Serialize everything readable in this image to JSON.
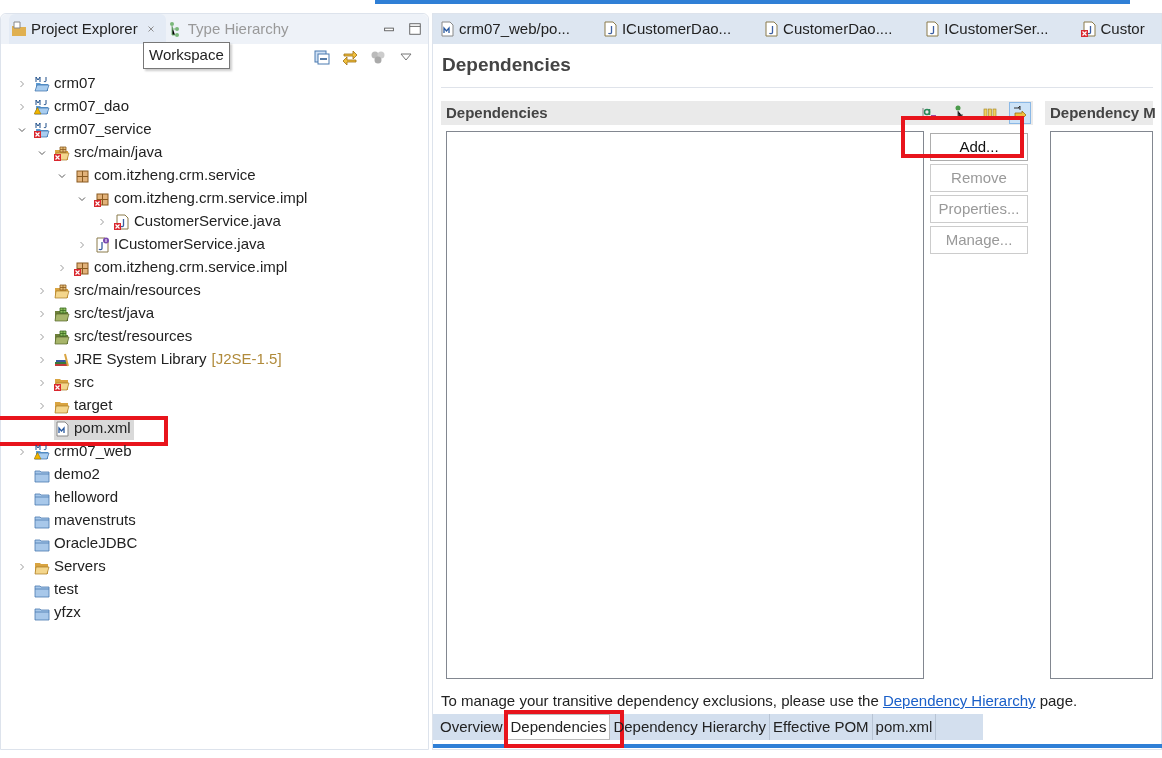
{
  "explorer": {
    "tabs": [
      {
        "label": "Project Explorer",
        "selected": true,
        "closable": true
      },
      {
        "label": "Type Hierarchy",
        "selected": false,
        "closable": false
      }
    ],
    "tooltip": "Workspace",
    "tree": [
      {
        "label": "crm07",
        "kind": "maven-project",
        "error": false,
        "warning": false,
        "expanded": false,
        "selected": false,
        "highlighted": false
      },
      {
        "label": "crm07_dao",
        "kind": "maven-project",
        "error": false,
        "warning": true,
        "expanded": false,
        "selected": false,
        "highlighted": false
      },
      {
        "label": "crm07_service",
        "kind": "maven-project",
        "error": true,
        "warning": false,
        "expanded": true,
        "selected": false,
        "highlighted": false,
        "children": [
          {
            "label": "src/main/java",
            "kind": "source-folder",
            "error": true,
            "warning": false,
            "expanded": true,
            "selected": false,
            "highlighted": false,
            "children": [
              {
                "label": "com.itzheng.crm.service",
                "kind": "package",
                "error": false,
                "warning": false,
                "expanded": true,
                "selected": false,
                "highlighted": false,
                "children": [
                  {
                    "label": "com.itzheng.crm.service.impl",
                    "kind": "package",
                    "error": true,
                    "warning": false,
                    "expanded": true,
                    "selected": false,
                    "highlighted": false,
                    "children": [
                      {
                        "label": "CustomerService.java",
                        "kind": "java-file",
                        "error": true,
                        "warning": false,
                        "expanded": false,
                        "selected": false,
                        "highlighted": false
                      }
                    ]
                  },
                  {
                    "label": "ICustomerService.java",
                    "kind": "interface-file",
                    "error": false,
                    "warning": false,
                    "expanded": false,
                    "selected": false,
                    "highlighted": false
                  }
                ]
              },
              {
                "label": "com.itzheng.crm.service.impl",
                "kind": "package",
                "error": true,
                "warning": false,
                "expanded": false,
                "selected": false,
                "highlighted": false
              }
            ]
          },
          {
            "label": "src/main/resources",
            "kind": "source-folder",
            "error": false,
            "warning": false,
            "expanded": false,
            "selected": false,
            "highlighted": false
          },
          {
            "label": "src/test/java",
            "kind": "test-folder",
            "error": false,
            "warning": false,
            "expanded": false,
            "selected": false,
            "highlighted": false
          },
          {
            "label": "src/test/resources",
            "kind": "test-folder",
            "error": false,
            "warning": false,
            "expanded": false,
            "selected": false,
            "highlighted": false
          },
          {
            "label": "JRE System Library",
            "suffix": "[J2SE-1.5]",
            "kind": "library",
            "error": false,
            "warning": false,
            "expanded": false,
            "selected": false,
            "highlighted": false
          },
          {
            "label": "src",
            "kind": "open-folder",
            "error": true,
            "warning": false,
            "expanded": false,
            "selected": false,
            "highlighted": false
          },
          {
            "label": "target",
            "kind": "open-folder",
            "error": false,
            "warning": false,
            "expanded": false,
            "selected": false,
            "highlighted": false
          },
          {
            "label": "pom.xml",
            "kind": "pom-file",
            "error": false,
            "warning": false,
            "selected": true,
            "highlighted": true
          }
        ]
      },
      {
        "label": "crm07_web",
        "kind": "maven-project",
        "error": false,
        "warning": true,
        "expanded": false,
        "selected": false,
        "highlighted": false
      },
      {
        "label": "demo2",
        "kind": "closed-project",
        "selected": false,
        "highlighted": false
      },
      {
        "label": "helloword",
        "kind": "closed-project",
        "selected": false,
        "highlighted": false
      },
      {
        "label": "mavenstruts",
        "kind": "closed-project",
        "selected": false,
        "highlighted": false
      },
      {
        "label": "OracleJDBC",
        "kind": "closed-project",
        "selected": false,
        "highlighted": false
      },
      {
        "label": "Servers",
        "kind": "open-folder",
        "expanded": false,
        "selected": false,
        "highlighted": false
      },
      {
        "label": "test",
        "kind": "closed-project",
        "selected": false,
        "highlighted": false
      },
      {
        "label": "yfzx",
        "kind": "closed-project",
        "selected": false,
        "highlighted": false
      }
    ]
  },
  "editor": {
    "tabs": [
      {
        "label": "crm07_web/po...",
        "kind": "pom-file"
      },
      {
        "label": "ICustomerDao...",
        "kind": "java-file"
      },
      {
        "label": "CustomerDao....",
        "kind": "java-file"
      },
      {
        "label": "ICustomerSer...",
        "kind": "java-file"
      },
      {
        "label": "Custor",
        "kind": "java-file",
        "error": true
      }
    ],
    "page_title": "Dependencies",
    "sections": [
      {
        "title": "Dependencies",
        "toolbar": [
          {
            "kind": "sort",
            "pressed": false
          },
          {
            "kind": "tree",
            "pressed": false
          },
          {
            "kind": "columns",
            "pressed": false
          },
          {
            "kind": "indent",
            "pressed": true
          }
        ],
        "buttons": [
          {
            "label": "Add...",
            "disabled": false,
            "highlighted": true
          },
          {
            "label": "Remove",
            "disabled": true,
            "highlighted": false
          },
          {
            "label": "Properties...",
            "disabled": true,
            "highlighted": false
          },
          {
            "label": "Manage...",
            "disabled": true,
            "highlighted": false
          }
        ]
      },
      {
        "title": "Dependency M"
      }
    ],
    "note": {
      "before": "To manage your transitive dependency exclusions, please use the ",
      "link": "Dependency Hierarchy",
      "after": " page."
    },
    "page_tabs": [
      {
        "label": "Overview",
        "selected": false,
        "highlighted": false
      },
      {
        "label": "Dependencies",
        "selected": true,
        "highlighted": true
      },
      {
        "label": "Dependency Hierarchy",
        "selected": false,
        "highlighted": false
      },
      {
        "label": "Effective POM",
        "selected": false,
        "highlighted": false
      },
      {
        "label": "pom.xml",
        "selected": false,
        "highlighted": false
      }
    ]
  }
}
